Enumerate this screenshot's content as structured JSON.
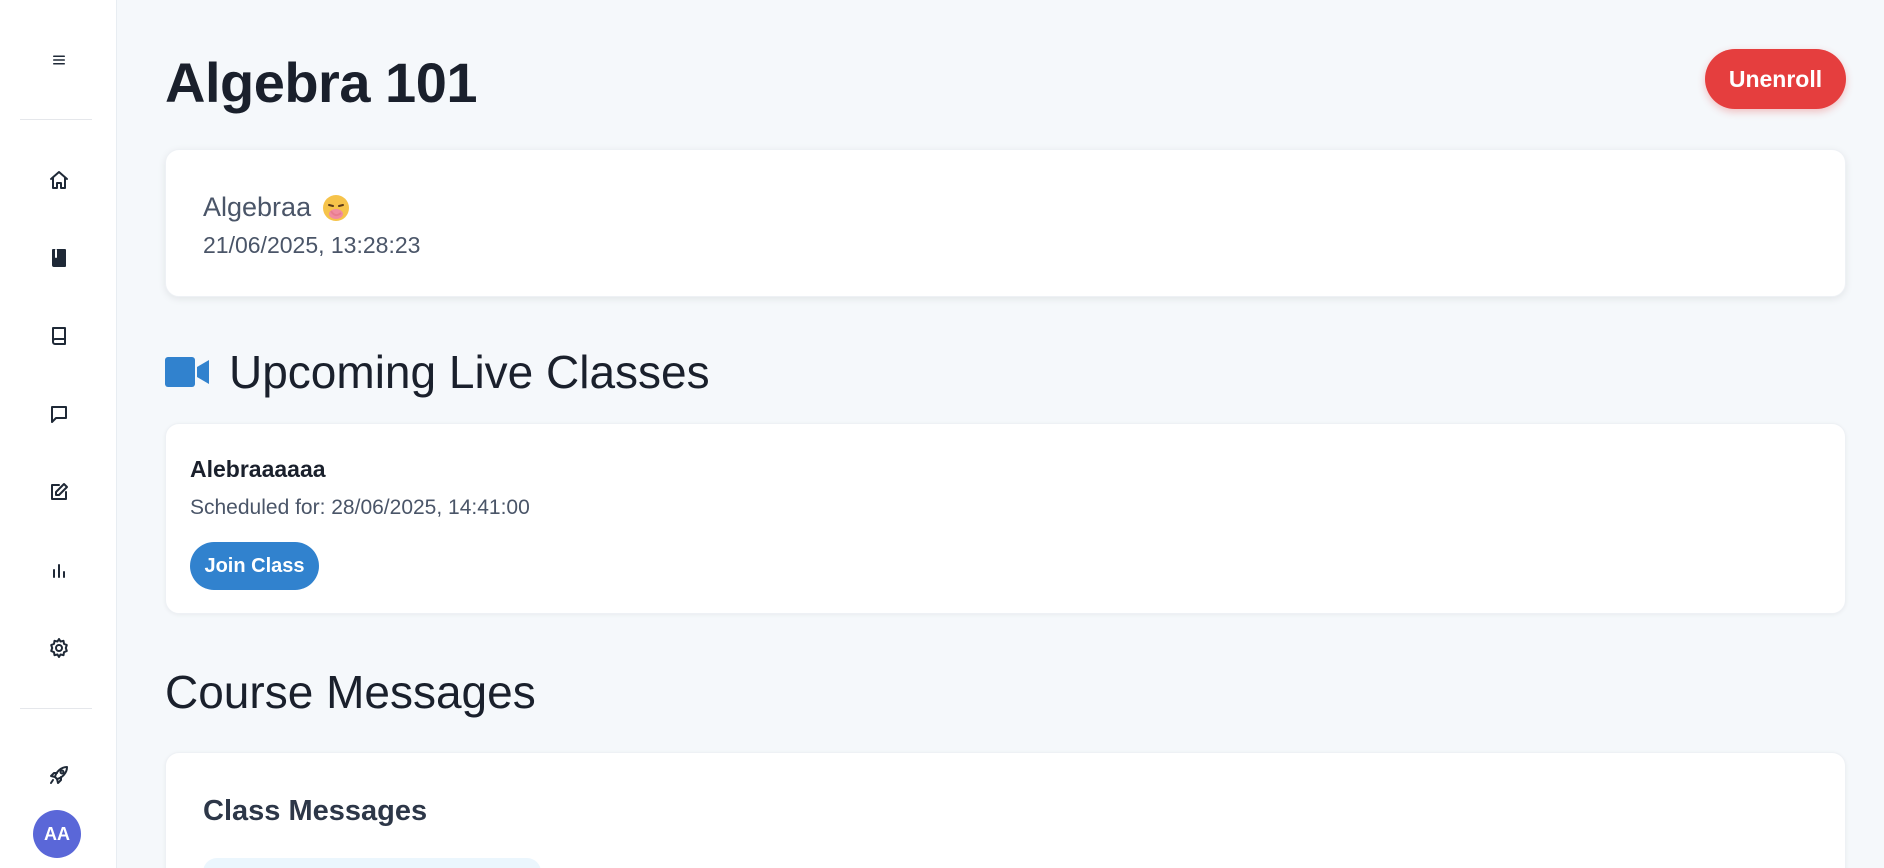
{
  "sidebar": {
    "items": [
      {
        "icon": "menu-icon"
      },
      {
        "icon": "home-icon"
      },
      {
        "icon": "book-filled-icon"
      },
      {
        "icon": "book-icon"
      },
      {
        "icon": "chat-icon"
      },
      {
        "icon": "edit-icon"
      },
      {
        "icon": "bar-chart-icon"
      },
      {
        "icon": "gear-icon"
      },
      {
        "icon": "rocket-icon"
      }
    ],
    "avatar_initials": "AA"
  },
  "header": {
    "title": "Algebra 101",
    "unenroll_label": "Unenroll"
  },
  "course": {
    "name": "Algebraa",
    "emoji": "face-with-hand-over-mouth",
    "date": "21/06/2025, 13:28:23"
  },
  "live_classes": {
    "section_title": "Upcoming Live Classes",
    "icon": "video-camera-icon",
    "items": [
      {
        "name": "Alebraaaaaa",
        "scheduled": "Scheduled for: 28/06/2025, 14:41:00",
        "join_label": "Join Class"
      }
    ]
  },
  "messages": {
    "section_title": "Course Messages",
    "card_title": "Class Messages"
  },
  "colors": {
    "accent": "#3182ce",
    "danger": "#e53e3e",
    "avatar": "#5a67d8",
    "background": "#f5f8fb"
  }
}
